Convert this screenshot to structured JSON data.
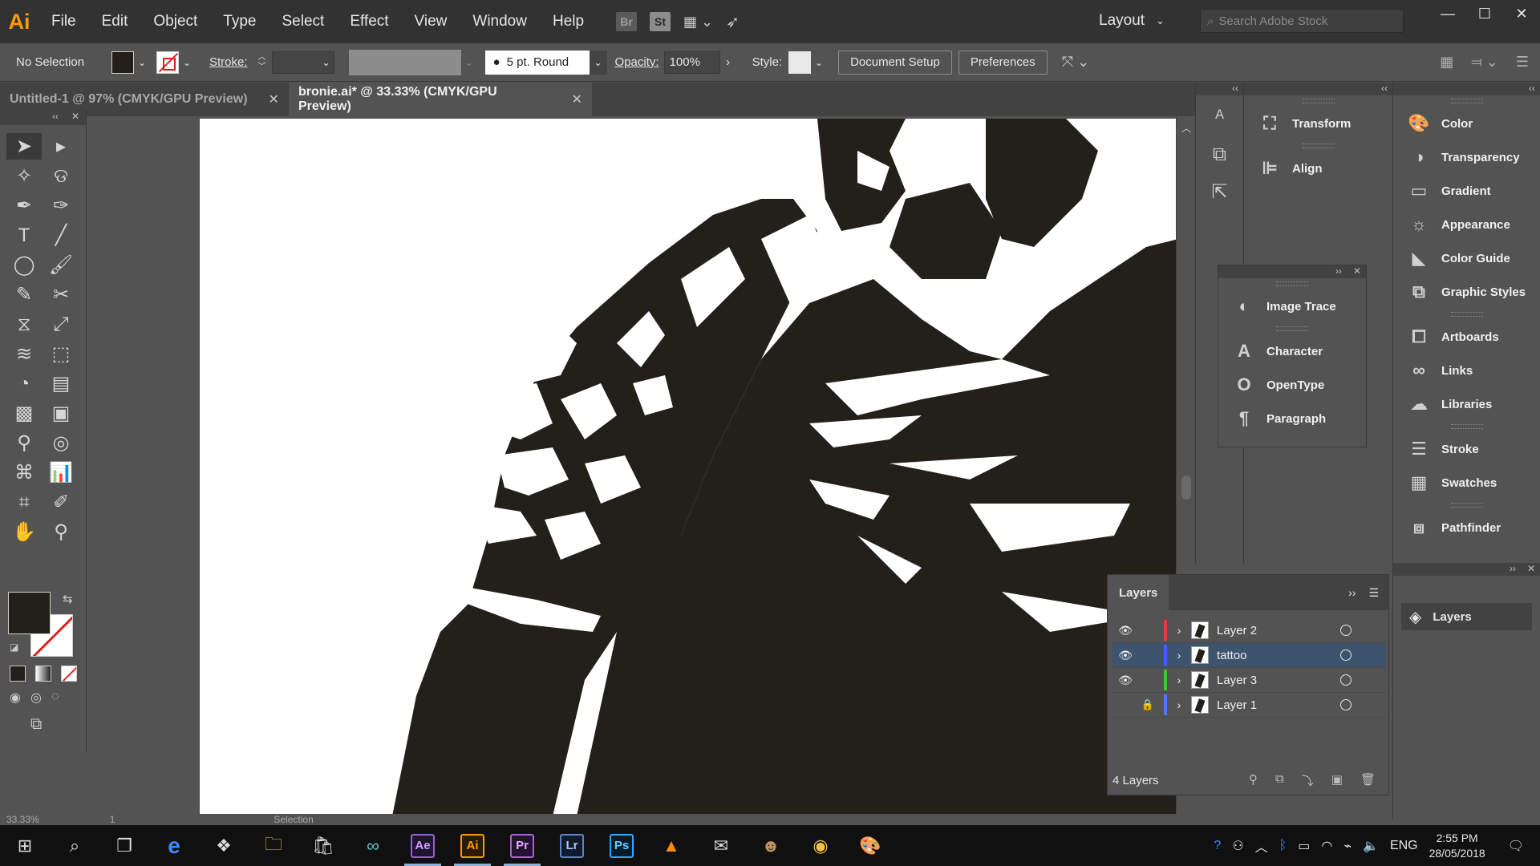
{
  "app": {
    "logo": "Ai",
    "workspace": "Layout",
    "search_placeholder": "Search Adobe Stock"
  },
  "menu": [
    "File",
    "Edit",
    "Object",
    "Type",
    "Select",
    "Effect",
    "View",
    "Window",
    "Help"
  ],
  "menu_icons": {
    "bridge": "Br",
    "stock": "St"
  },
  "control": {
    "selection": "No Selection",
    "stroke_label": "Stroke:",
    "brush": "5 pt. Round",
    "opacity_label": "Opacity:",
    "opacity_value": "100%",
    "style_label": "Style:",
    "doc_setup": "Document Setup",
    "preferences": "Preferences"
  },
  "tabs": [
    {
      "label": "Untitled-1 @ 97% (CMYK/GPU Preview)",
      "active": false
    },
    {
      "label": "bronie.ai* @ 33.33% (CMYK/GPU Preview)",
      "active": true
    }
  ],
  "status": {
    "zoom": "33.33%",
    "page": "1",
    "tool": "Selection"
  },
  "panels_col2": [
    "Transform",
    "Align"
  ],
  "panels_float": [
    "Image Trace",
    "Character",
    "OpenType",
    "Paragraph"
  ],
  "panels_col3": [
    "Color",
    "Transparency",
    "Gradient",
    "Appearance",
    "Color Guide",
    "Graphic Styles",
    "Artboards",
    "Links",
    "Libraries",
    "Stroke",
    "Swatches",
    "Pathfinder"
  ],
  "layers": {
    "title": "Layers",
    "count": "4 Layers",
    "rows": [
      {
        "name": "Layer 2",
        "color": "#e63c3c",
        "visible": true,
        "locked": false,
        "selected": false
      },
      {
        "name": "tattoo",
        "color": "#4b5cff",
        "visible": true,
        "locked": false,
        "selected": true
      },
      {
        "name": "Layer 3",
        "color": "#3cc83c",
        "visible": true,
        "locked": false,
        "selected": false
      },
      {
        "name": "Layer 1",
        "color": "#4b7cff",
        "visible": false,
        "locked": true,
        "selected": false
      }
    ]
  },
  "layers_collapsed_label": "Layers",
  "taskbar": {
    "apps": [
      "Ae",
      "Ai",
      "Pr",
      "Lr",
      "Ps"
    ],
    "lang": "ENG",
    "time": "2:55 PM",
    "date": "28/05/2018"
  },
  "colors": {
    "fill": "#231f1a",
    "accent": "#ff9a00",
    "selected_row": "#3e546e"
  }
}
